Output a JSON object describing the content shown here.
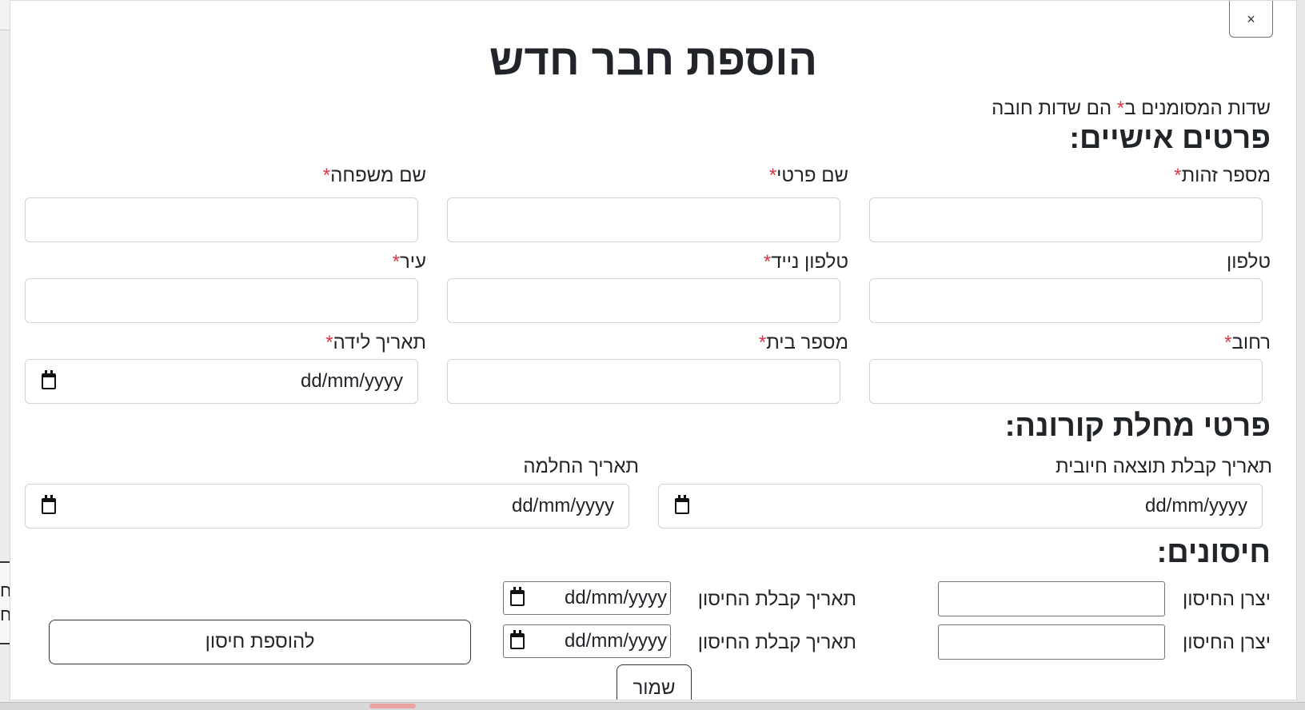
{
  "modal": {
    "close_label": "×",
    "title": "הוספת חבר חדש",
    "required_note_prefix": "שדות המסומנים ב",
    "required_star": "*",
    "required_note_suffix": " הם שדות חובה"
  },
  "personal": {
    "section_title": "פרטים אישיים:",
    "fields": {
      "id_number": {
        "label": "מספר זהות",
        "required": "*",
        "value": ""
      },
      "first_name": {
        "label": "שם פרטי",
        "required": "*",
        "value": ""
      },
      "last_name": {
        "label": "שם משפחה",
        "required": "*",
        "value": ""
      },
      "phone": {
        "label": "טלפון",
        "value": ""
      },
      "mobile": {
        "label": "טלפון נייד",
        "required": "*",
        "value": ""
      },
      "city": {
        "label": "עיר",
        "required": "*",
        "value": ""
      },
      "street": {
        "label": "רחוב",
        "required": "*",
        "value": ""
      },
      "house_number": {
        "label": "מספר בית",
        "required": "*",
        "value": ""
      },
      "birth_date": {
        "label": "תאריך לידה",
        "required": "*",
        "placeholder": "dd/mm/yyyy"
      }
    }
  },
  "corona": {
    "section_title": "פרטי מחלת קורונה:",
    "positive_date": {
      "label": "תאריך קבלת תוצאה חיובית",
      "placeholder": "dd/mm/yyyy"
    },
    "recovery_date": {
      "label": "תאריך החלמה",
      "placeholder": "dd/mm/yyyy"
    }
  },
  "vaccines": {
    "section_title": "חיסונים:",
    "rows": [
      {
        "manufacturer_label": "יצרן החיסון",
        "manufacturer_value": "",
        "date_label": "תאריך קבלת החיסון",
        "date_placeholder": "dd/mm/yyyy"
      },
      {
        "manufacturer_label": "יצרן החיסון",
        "manufacturer_value": "",
        "date_label": "תאריך קבלת החיסון",
        "date_placeholder": "dd/mm/yyyy"
      }
    ],
    "add_button": "להוספת חיסון"
  },
  "save_button": "שמור",
  "background": {
    "left_card_text": "ח ח"
  }
}
